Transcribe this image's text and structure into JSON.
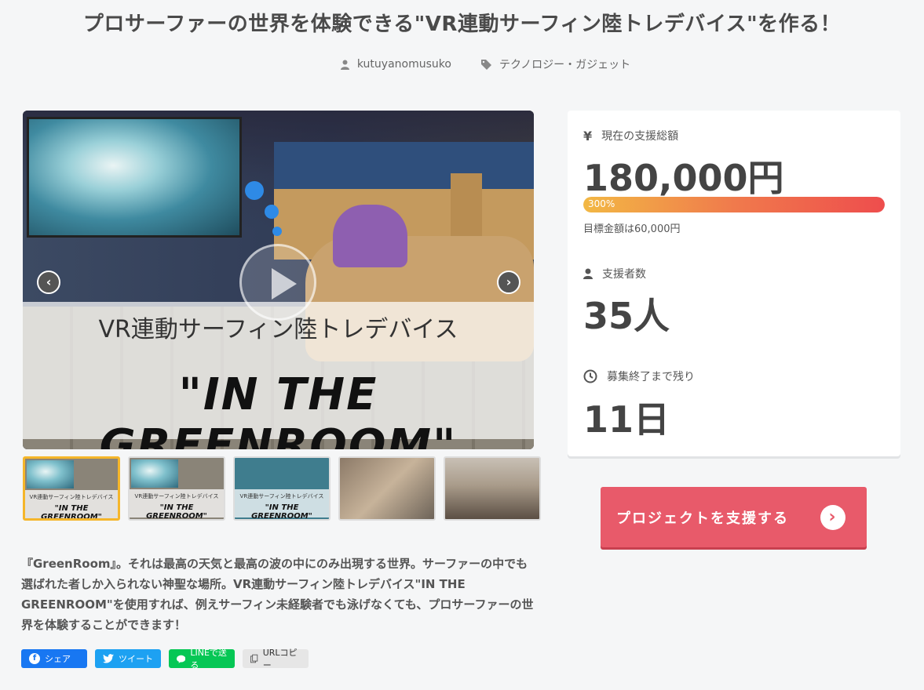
{
  "page": {
    "title": "プロサーファーの世界を体験できる\"VR連動サーフィン陸トレデバイス\"を作る！",
    "author": "kutuyanomusuko",
    "category": "テクノロジー・ガジェット"
  },
  "media": {
    "overlay_sub": "VR連動サーフィン陸トレデバイス",
    "overlay_main": "\"IN THE GREENROOM\"",
    "prev_glyph": "‹",
    "next_glyph": "›",
    "thumbnails": [
      {
        "sub": "VR連動サーフィン陸トレデバイス",
        "main": "\"IN THE GREENROOM\""
      },
      {
        "sub": "VR連動サーフィン陸トレデバイス",
        "main": "\"IN THE GREENROOM\""
      },
      {
        "sub": "VR連動サーフィン陸トレデバイス",
        "main": "\"IN THE GREENROOM\""
      },
      {
        "sub": "",
        "main": ""
      },
      {
        "sub": "",
        "main": ""
      }
    ]
  },
  "description": "『GreenRoom』。それは最高の天気と最高の波の中にのみ出現する世界。サーファーの中でも選ばれた者しか入られない神聖な場所。VR連動サーフィン陸トレデバイス\"IN THE GREENROOM\"を使用すれば、例えサーフィン未経験者でも泳げなくても、プロサーファーの世界を体験することができます！",
  "share": {
    "facebook": "シェア",
    "twitter": "ツイート",
    "line": "LINEで送る",
    "url_copy": "URLコピー"
  },
  "stats": {
    "amount_label": "現在の支援総額",
    "amount_value": "180,000円",
    "progress_percent": "300%",
    "goal_text": "目標金額は60,000円",
    "supporters_label": "支援者数",
    "supporters_value": "35人",
    "remaining_label": "募集終了まで残り",
    "remaining_value": "11日"
  },
  "cta": {
    "label": "プロジェクトを支援する"
  },
  "colors": {
    "cta": "#e85a6a",
    "progress_start": "#f2b844",
    "progress_end": "#ee4d4d",
    "facebook": "#1877f2",
    "twitter": "#1da1f2",
    "line": "#06c755"
  }
}
